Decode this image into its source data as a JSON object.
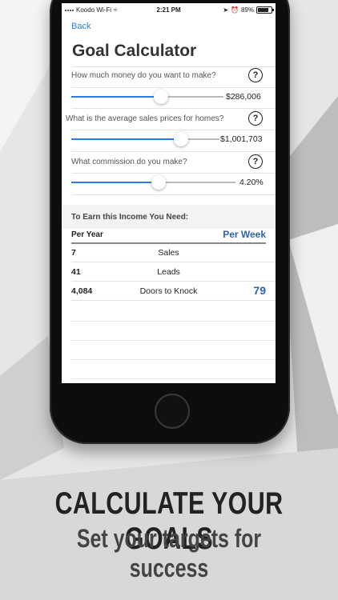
{
  "status_bar": {
    "carrier": "Koodo Wi-Fi",
    "time": "2:21 PM",
    "battery_percent": "89%",
    "battery_level": 0.89
  },
  "nav": {
    "back_label": "Back"
  },
  "page_title": "Goal Calculator",
  "inputs": [
    {
      "question": "How much money do you want to make?",
      "help": "?",
      "value": "$286,006",
      "slider_fraction": 0.59
    },
    {
      "question": "What is the average sales prices for homes?",
      "help": "?",
      "value": "$1,001,703",
      "slider_fraction": 0.74
    },
    {
      "question": "What commission do you make?",
      "help": "?",
      "value": "4.20%",
      "slider_fraction": 0.53
    }
  ],
  "results": {
    "section_title": "To Earn this Income You Need:",
    "col_year": "Per Year",
    "col_week": "Per Week",
    "rows": [
      {
        "year_value": "7",
        "label": "Sales",
        "week_value": ""
      },
      {
        "year_value": "41",
        "label": "Leads",
        "week_value": ""
      },
      {
        "year_value": "4,084",
        "label": "Doors to Knock",
        "week_value": "79"
      }
    ]
  },
  "promo": {
    "headline": "CALCULATE YOUR GOALS",
    "subheadline": "Set your targets for success"
  },
  "colors": {
    "accent": "#2b7de1",
    "per_week": "#2b63b8",
    "text": "#222222"
  }
}
